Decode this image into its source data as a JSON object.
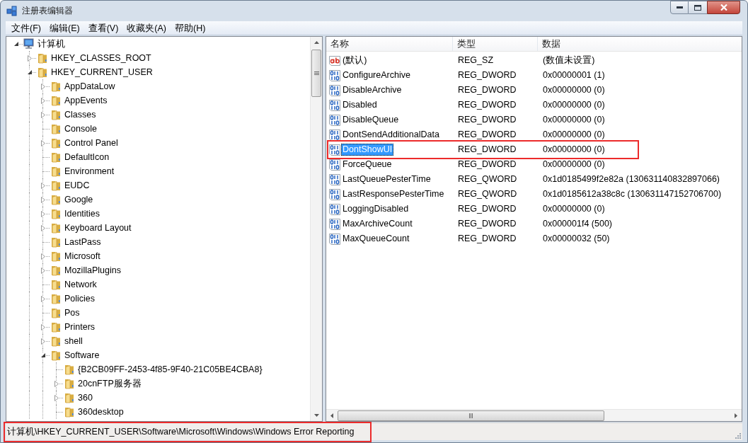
{
  "window": {
    "title": "注册表编辑器"
  },
  "menu": [
    "文件(F)",
    "编辑(E)",
    "查看(V)",
    "收藏夹(A)",
    "帮助(H)"
  ],
  "tree": [
    {
      "kind": "computer",
      "label": "计算机",
      "expanded": true,
      "children": [
        {
          "kind": "folder",
          "label": "HKEY_CLASSES_ROOT",
          "expanded": false
        },
        {
          "kind": "folder",
          "label": "HKEY_CURRENT_USER",
          "expanded": true,
          "children": [
            {
              "kind": "folder",
              "label": "AppDataLow",
              "expanded": false
            },
            {
              "kind": "folder",
              "label": "AppEvents",
              "expanded": false
            },
            {
              "kind": "folder",
              "label": "Classes",
              "expanded": false
            },
            {
              "kind": "folder",
              "label": "Console"
            },
            {
              "kind": "folder",
              "label": "Control Panel",
              "expanded": false
            },
            {
              "kind": "folder",
              "label": "DefaultIcon"
            },
            {
              "kind": "folder",
              "label": "Environment"
            },
            {
              "kind": "folder",
              "label": "EUDC",
              "expanded": false
            },
            {
              "kind": "folder",
              "label": "Google",
              "expanded": false
            },
            {
              "kind": "folder",
              "label": "Identities",
              "expanded": false
            },
            {
              "kind": "folder",
              "label": "Keyboard Layout",
              "expanded": false
            },
            {
              "kind": "folder",
              "label": "LastPass"
            },
            {
              "kind": "folder",
              "label": "Microsoft",
              "expanded": false
            },
            {
              "kind": "folder",
              "label": "MozillaPlugins",
              "expanded": false
            },
            {
              "kind": "folder",
              "label": "Network"
            },
            {
              "kind": "folder",
              "label": "Policies",
              "expanded": false
            },
            {
              "kind": "folder",
              "label": "Pos"
            },
            {
              "kind": "folder",
              "label": "Printers",
              "expanded": false
            },
            {
              "kind": "folder",
              "label": "shell",
              "expanded": false
            },
            {
              "kind": "folder",
              "label": "Software",
              "expanded": true,
              "children": [
                {
                  "kind": "folder",
                  "label": "{B2CB09FF-2453-4f85-9F40-21C05BE4CBA8}"
                },
                {
                  "kind": "folder",
                  "label": "20cnFTP服务器",
                  "expanded": false
                },
                {
                  "kind": "folder",
                  "label": "360",
                  "expanded": false
                },
                {
                  "kind": "folder",
                  "label": "360desktop"
                }
              ]
            }
          ]
        }
      ]
    }
  ],
  "list": {
    "columns": [
      "名称",
      "类型",
      "数据"
    ],
    "rows": [
      {
        "kind": "string",
        "name": "(默认)",
        "type": "REG_SZ",
        "data": "(数值未设置)",
        "selected": false,
        "annotated": false
      },
      {
        "kind": "binary",
        "name": "ConfigureArchive",
        "type": "REG_DWORD",
        "data": "0x00000001 (1)",
        "selected": false,
        "annotated": false
      },
      {
        "kind": "binary",
        "name": "DisableArchive",
        "type": "REG_DWORD",
        "data": "0x00000000 (0)",
        "selected": false,
        "annotated": false
      },
      {
        "kind": "binary",
        "name": "Disabled",
        "type": "REG_DWORD",
        "data": "0x00000000 (0)",
        "selected": false,
        "annotated": false
      },
      {
        "kind": "binary",
        "name": "DisableQueue",
        "type": "REG_DWORD",
        "data": "0x00000000 (0)",
        "selected": false,
        "annotated": false
      },
      {
        "kind": "binary",
        "name": "DontSendAdditionalData",
        "type": "REG_DWORD",
        "data": "0x00000000 (0)",
        "selected": false,
        "annotated": false
      },
      {
        "kind": "binary",
        "name": "DontShowUI",
        "type": "REG_DWORD",
        "data": "0x00000000 (0)",
        "selected": true,
        "annotated": true
      },
      {
        "kind": "binary",
        "name": "ForceQueue",
        "type": "REG_DWORD",
        "data": "0x00000000 (0)",
        "selected": false,
        "annotated": false
      },
      {
        "kind": "binary",
        "name": "LastQueuePesterTime",
        "type": "REG_QWORD",
        "data": "0x1d0185499f2e82a (130631140832897066)",
        "selected": false,
        "annotated": false
      },
      {
        "kind": "binary",
        "name": "LastResponsePesterTime",
        "type": "REG_QWORD",
        "data": "0x1d0185612a38c8c (130631147152706700)",
        "selected": false,
        "annotated": false
      },
      {
        "kind": "binary",
        "name": "LoggingDisabled",
        "type": "REG_DWORD",
        "data": "0x00000000 (0)",
        "selected": false,
        "annotated": false
      },
      {
        "kind": "binary",
        "name": "MaxArchiveCount",
        "type": "REG_DWORD",
        "data": "0x000001f4 (500)",
        "selected": false,
        "annotated": false
      },
      {
        "kind": "binary",
        "name": "MaxQueueCount",
        "type": "REG_DWORD",
        "data": "0x00000032 (50)",
        "selected": false,
        "annotated": false
      }
    ]
  },
  "status_bar": {
    "text": "计算机\\HKEY_CURRENT_USER\\Software\\Microsoft\\Windows\\Windows Error Reporting",
    "annotated": true
  }
}
